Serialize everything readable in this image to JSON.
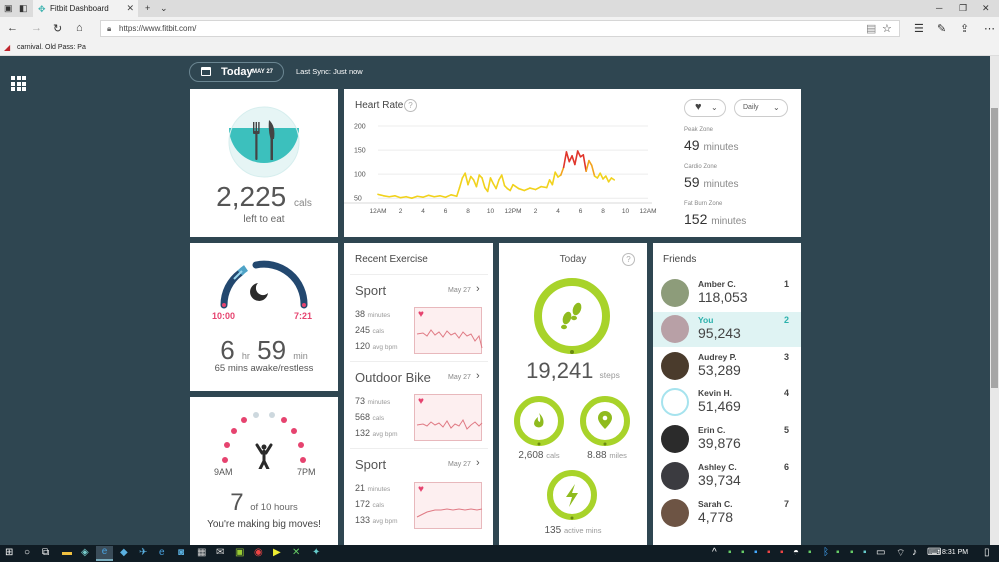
{
  "browser": {
    "tab_title": "Fitbit Dashboard",
    "url": "https://www.fitbit.com/",
    "favorite_label": "carnival. Old Pass: Pa"
  },
  "header": {
    "today": "Today",
    "date": "MAY 27",
    "last_sync": "Last Sync: Just now"
  },
  "food": {
    "calories": "2,225",
    "calories_unit": "cals",
    "label": "left to eat"
  },
  "heart": {
    "title": "Heart Rate",
    "help": "?",
    "period": "Daily",
    "zones": [
      {
        "name": "Peak Zone",
        "value": "49",
        "unit": "minutes"
      },
      {
        "name": "Cardio Zone",
        "value": "59",
        "unit": "minutes"
      },
      {
        "name": "Fat Burn Zone",
        "value": "152",
        "unit": "minutes"
      }
    ]
  },
  "chart_data": {
    "type": "line",
    "title": "Heart Rate",
    "ylim": [
      40,
      200
    ],
    "y_ticks": [
      "200",
      "150",
      "100",
      "50"
    ],
    "x_ticks": [
      "12AM",
      "2",
      "4",
      "6",
      "8",
      "10",
      "12PM",
      "2",
      "4",
      "6",
      "8",
      "10",
      "12AM"
    ],
    "x": [
      0,
      0.5,
      1,
      1.5,
      2,
      2.5,
      3,
      3.5,
      4,
      4.5,
      5,
      5.5,
      6,
      6.5,
      7,
      7.25,
      7.5,
      7.75,
      8,
      8.25,
      8.5,
      8.75,
      9,
      9.25,
      9.5,
      9.75,
      10,
      10.25,
      10.5,
      10.75,
      11,
      11.25,
      11.5,
      11.75,
      12,
      12.5,
      13,
      13.5,
      14,
      14.5,
      15,
      15.25,
      15.5,
      15.75,
      16,
      16.25,
      16.5,
      16.75,
      17,
      17.25,
      17.5,
      17.75,
      18,
      18.25,
      18.5,
      18.75,
      19,
      19.25,
      19.5,
      19.75,
      20,
      20.25,
      20.5,
      20.75,
      21
    ],
    "values": [
      58,
      55,
      53,
      55,
      51,
      53,
      50,
      54,
      52,
      56,
      53,
      55,
      52,
      57,
      54,
      72,
      92,
      102,
      78,
      95,
      88,
      74,
      98,
      92,
      72,
      64,
      92,
      80,
      70,
      88,
      98,
      76,
      70,
      66,
      78,
      70,
      66,
      71,
      68,
      74,
      72,
      88,
      78,
      104,
      94,
      98,
      114,
      146,
      126,
      138,
      120,
      148,
      136,
      140,
      106,
      128,
      118,
      96,
      92,
      102,
      90,
      96,
      84,
      92,
      88
    ]
  },
  "sleep": {
    "start": "10:00",
    "end": "7:21",
    "hours": "6",
    "hours_unit": "hr",
    "minutes": "59",
    "minutes_unit": "min",
    "restless": "65 mins awake/restless"
  },
  "hourly": {
    "start": "9AM",
    "end": "7PM",
    "count": "7",
    "count_suffix": "of 10 hours",
    "message": "You're making big moves!"
  },
  "exercise": {
    "title": "Recent Exercise",
    "items": [
      {
        "name": "Sport",
        "date": "May 27",
        "minutes": "38",
        "cals": "245",
        "bpm": "120"
      },
      {
        "name": "Outdoor Bike",
        "date": "May 27",
        "minutes": "73",
        "cals": "568",
        "bpm": "132"
      },
      {
        "name": "Sport",
        "date": "May 27",
        "minutes": "21",
        "cals": "172",
        "bpm": "133"
      }
    ],
    "units": {
      "minutes": "minutes",
      "cals": "cals",
      "bpm": "avg bpm"
    }
  },
  "today": {
    "title": "Today",
    "help": "?",
    "steps": "19,241",
    "steps_unit": "steps",
    "cals": "2,608",
    "cals_unit": "cals",
    "miles": "8.88",
    "miles_unit": "miles",
    "active": "135",
    "active_unit": "active mins"
  },
  "friends": {
    "title": "Friends",
    "items": [
      {
        "name": "Amber C.",
        "steps": "118,053",
        "rank": "1"
      },
      {
        "name": "You",
        "steps": "95,243",
        "rank": "2"
      },
      {
        "name": "Audrey P.",
        "steps": "53,289",
        "rank": "3"
      },
      {
        "name": "Kevin H.",
        "steps": "51,469",
        "rank": "4"
      },
      {
        "name": "Erin C.",
        "steps": "39,876",
        "rank": "5"
      },
      {
        "name": "Ashley C.",
        "steps": "39,734",
        "rank": "6"
      },
      {
        "name": "Sarah C.",
        "steps": "4,778",
        "rank": "7"
      }
    ]
  },
  "taskbar": {
    "time": "8:31 PM"
  },
  "colors": {
    "teal": "#3cc0bd",
    "green": "#a8d32a",
    "navy": "#23486f",
    "pink": "#e6436f",
    "bg": "#2f4651"
  }
}
